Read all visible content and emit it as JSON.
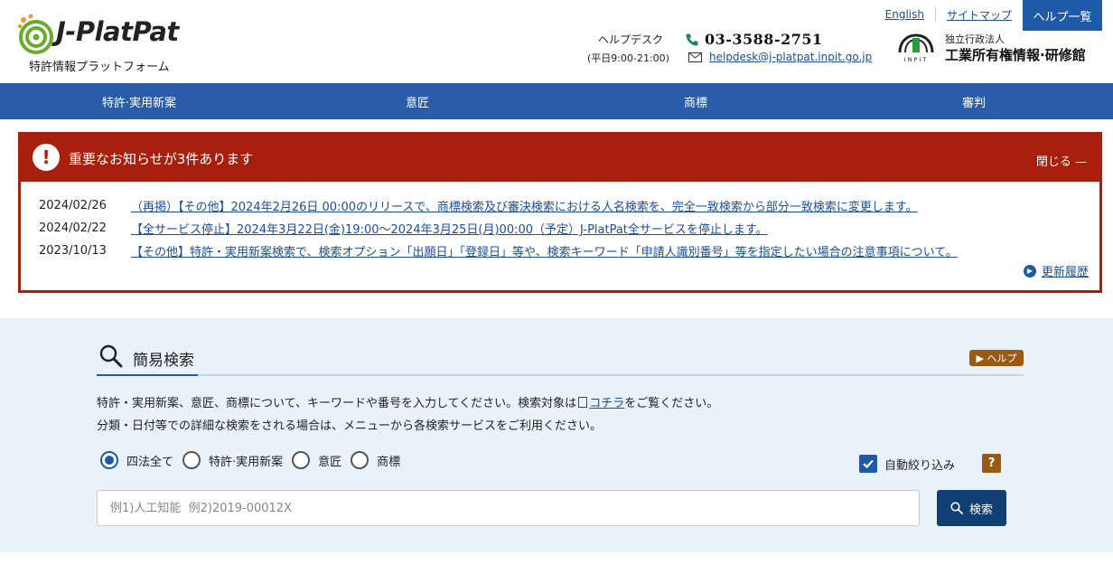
{
  "header": {
    "logo_text": "J-PlatPat",
    "logo_sub": "特許情報プラットフォーム",
    "links": [
      "English",
      "サイトマップ"
    ],
    "help_list_label": "ヘルプ一覧",
    "helpdesk_label": "ヘルプデスク",
    "helpdesk_hours": "(平日9:00-21:00)",
    "phone": "03-3588-2751",
    "email": "helpdesk@j-platpat.inpit.go.jp",
    "org_small": "独立行政法人",
    "org_name": "工業所有権情報·研修館",
    "org_logo_text": "INPIT"
  },
  "nav": {
    "items": [
      "特許·実用新案",
      "意匠",
      "商標",
      "審判"
    ]
  },
  "alert": {
    "title": "重要なお知らせが3件あります",
    "close_label": "閉じる —",
    "news": [
      {
        "date": "2024/02/26",
        "text": "（再掲）【その他】2024年2月26日 00:00のリリースで、商標検索及び審決検索における人名検索を、完全一致検索から部分一致検索に変更します。"
      },
      {
        "date": "2024/02/22",
        "text": "【全サービス停止】2024年3月22日(金)19:00～2024年3月25日(月)00:00（予定）J-PlatPat全サービスを停止します。"
      },
      {
        "date": "2023/10/13",
        "text": "【その他】特許・実用新案検索で、検索オプション「出願日」「登録日」等や、検索キーワード「申請人識別番号」等を指定したい場合の注意事項について。"
      }
    ],
    "history_label": "更新履歴"
  },
  "search": {
    "title": "簡易検索",
    "help_label": "ヘルプ",
    "desc1_before": "特許・実用新案、意匠、商標について、キーワードや番号を入力してください。検索対象は",
    "desc1_link": "コチラ",
    "desc1_after": "をご覧ください。",
    "desc2": "分類・日付等での詳細な検索をされる場合は、メニューから各検索サービスをご利用ください。",
    "radios": [
      "四法全て",
      "特許·実用新案",
      "意匠",
      "商標"
    ],
    "selected_index": 0,
    "auto_narrow_label": "自動絞り込み",
    "auto_narrow_checked": true,
    "question_label": "?",
    "placeholder": "例1)人工知能  例2)2019-00012X",
    "button_label": "検索"
  }
}
